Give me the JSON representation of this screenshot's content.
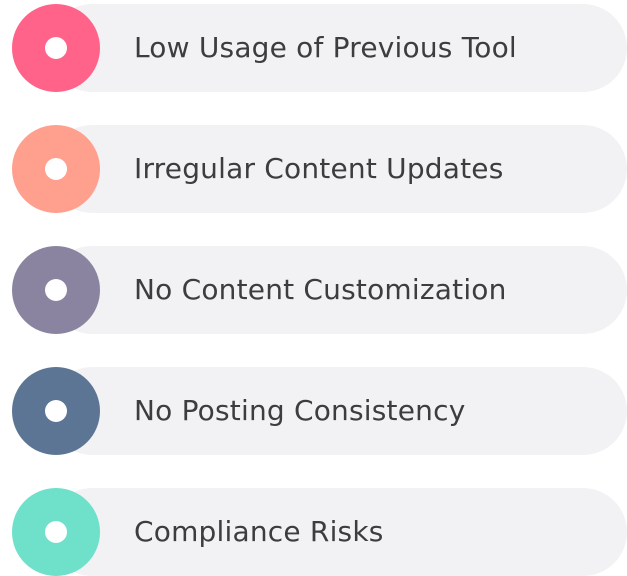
{
  "items": [
    {
      "label": "Low Usage of Previous Tool",
      "color": "#ff6389"
    },
    {
      "label": "Irregular Content Updates",
      "color": "#ffa08f"
    },
    {
      "label": "No Content Customization",
      "color": "#8b84a1"
    },
    {
      "label": "No Posting Consistency",
      "color": "#5c7594"
    },
    {
      "label": "Compliance Risks",
      "color": "#6fe0c9"
    }
  ]
}
